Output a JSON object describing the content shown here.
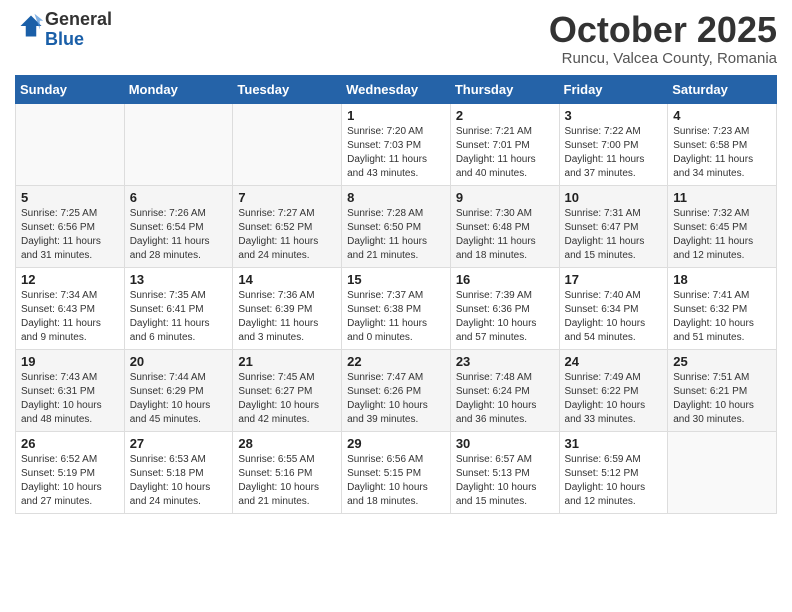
{
  "logo": {
    "general": "General",
    "blue": "Blue"
  },
  "header": {
    "title": "October 2025",
    "subtitle": "Runcu, Valcea County, Romania"
  },
  "weekdays": [
    "Sunday",
    "Monday",
    "Tuesday",
    "Wednesday",
    "Thursday",
    "Friday",
    "Saturday"
  ],
  "weeks": [
    [
      {
        "day": "",
        "sunrise": "",
        "sunset": "",
        "daylight": ""
      },
      {
        "day": "",
        "sunrise": "",
        "sunset": "",
        "daylight": ""
      },
      {
        "day": "",
        "sunrise": "",
        "sunset": "",
        "daylight": ""
      },
      {
        "day": "1",
        "sunrise": "Sunrise: 7:20 AM",
        "sunset": "Sunset: 7:03 PM",
        "daylight": "Daylight: 11 hours and 43 minutes."
      },
      {
        "day": "2",
        "sunrise": "Sunrise: 7:21 AM",
        "sunset": "Sunset: 7:01 PM",
        "daylight": "Daylight: 11 hours and 40 minutes."
      },
      {
        "day": "3",
        "sunrise": "Sunrise: 7:22 AM",
        "sunset": "Sunset: 7:00 PM",
        "daylight": "Daylight: 11 hours and 37 minutes."
      },
      {
        "day": "4",
        "sunrise": "Sunrise: 7:23 AM",
        "sunset": "Sunset: 6:58 PM",
        "daylight": "Daylight: 11 hours and 34 minutes."
      }
    ],
    [
      {
        "day": "5",
        "sunrise": "Sunrise: 7:25 AM",
        "sunset": "Sunset: 6:56 PM",
        "daylight": "Daylight: 11 hours and 31 minutes."
      },
      {
        "day": "6",
        "sunrise": "Sunrise: 7:26 AM",
        "sunset": "Sunset: 6:54 PM",
        "daylight": "Daylight: 11 hours and 28 minutes."
      },
      {
        "day": "7",
        "sunrise": "Sunrise: 7:27 AM",
        "sunset": "Sunset: 6:52 PM",
        "daylight": "Daylight: 11 hours and 24 minutes."
      },
      {
        "day": "8",
        "sunrise": "Sunrise: 7:28 AM",
        "sunset": "Sunset: 6:50 PM",
        "daylight": "Daylight: 11 hours and 21 minutes."
      },
      {
        "day": "9",
        "sunrise": "Sunrise: 7:30 AM",
        "sunset": "Sunset: 6:48 PM",
        "daylight": "Daylight: 11 hours and 18 minutes."
      },
      {
        "day": "10",
        "sunrise": "Sunrise: 7:31 AM",
        "sunset": "Sunset: 6:47 PM",
        "daylight": "Daylight: 11 hours and 15 minutes."
      },
      {
        "day": "11",
        "sunrise": "Sunrise: 7:32 AM",
        "sunset": "Sunset: 6:45 PM",
        "daylight": "Daylight: 11 hours and 12 minutes."
      }
    ],
    [
      {
        "day": "12",
        "sunrise": "Sunrise: 7:34 AM",
        "sunset": "Sunset: 6:43 PM",
        "daylight": "Daylight: 11 hours and 9 minutes."
      },
      {
        "day": "13",
        "sunrise": "Sunrise: 7:35 AM",
        "sunset": "Sunset: 6:41 PM",
        "daylight": "Daylight: 11 hours and 6 minutes."
      },
      {
        "day": "14",
        "sunrise": "Sunrise: 7:36 AM",
        "sunset": "Sunset: 6:39 PM",
        "daylight": "Daylight: 11 hours and 3 minutes."
      },
      {
        "day": "15",
        "sunrise": "Sunrise: 7:37 AM",
        "sunset": "Sunset: 6:38 PM",
        "daylight": "Daylight: 11 hours and 0 minutes."
      },
      {
        "day": "16",
        "sunrise": "Sunrise: 7:39 AM",
        "sunset": "Sunset: 6:36 PM",
        "daylight": "Daylight: 10 hours and 57 minutes."
      },
      {
        "day": "17",
        "sunrise": "Sunrise: 7:40 AM",
        "sunset": "Sunset: 6:34 PM",
        "daylight": "Daylight: 10 hours and 54 minutes."
      },
      {
        "day": "18",
        "sunrise": "Sunrise: 7:41 AM",
        "sunset": "Sunset: 6:32 PM",
        "daylight": "Daylight: 10 hours and 51 minutes."
      }
    ],
    [
      {
        "day": "19",
        "sunrise": "Sunrise: 7:43 AM",
        "sunset": "Sunset: 6:31 PM",
        "daylight": "Daylight: 10 hours and 48 minutes."
      },
      {
        "day": "20",
        "sunrise": "Sunrise: 7:44 AM",
        "sunset": "Sunset: 6:29 PM",
        "daylight": "Daylight: 10 hours and 45 minutes."
      },
      {
        "day": "21",
        "sunrise": "Sunrise: 7:45 AM",
        "sunset": "Sunset: 6:27 PM",
        "daylight": "Daylight: 10 hours and 42 minutes."
      },
      {
        "day": "22",
        "sunrise": "Sunrise: 7:47 AM",
        "sunset": "Sunset: 6:26 PM",
        "daylight": "Daylight: 10 hours and 39 minutes."
      },
      {
        "day": "23",
        "sunrise": "Sunrise: 7:48 AM",
        "sunset": "Sunset: 6:24 PM",
        "daylight": "Daylight: 10 hours and 36 minutes."
      },
      {
        "day": "24",
        "sunrise": "Sunrise: 7:49 AM",
        "sunset": "Sunset: 6:22 PM",
        "daylight": "Daylight: 10 hours and 33 minutes."
      },
      {
        "day": "25",
        "sunrise": "Sunrise: 7:51 AM",
        "sunset": "Sunset: 6:21 PM",
        "daylight": "Daylight: 10 hours and 30 minutes."
      }
    ],
    [
      {
        "day": "26",
        "sunrise": "Sunrise: 6:52 AM",
        "sunset": "Sunset: 5:19 PM",
        "daylight": "Daylight: 10 hours and 27 minutes."
      },
      {
        "day": "27",
        "sunrise": "Sunrise: 6:53 AM",
        "sunset": "Sunset: 5:18 PM",
        "daylight": "Daylight: 10 hours and 24 minutes."
      },
      {
        "day": "28",
        "sunrise": "Sunrise: 6:55 AM",
        "sunset": "Sunset: 5:16 PM",
        "daylight": "Daylight: 10 hours and 21 minutes."
      },
      {
        "day": "29",
        "sunrise": "Sunrise: 6:56 AM",
        "sunset": "Sunset: 5:15 PM",
        "daylight": "Daylight: 10 hours and 18 minutes."
      },
      {
        "day": "30",
        "sunrise": "Sunrise: 6:57 AM",
        "sunset": "Sunset: 5:13 PM",
        "daylight": "Daylight: 10 hours and 15 minutes."
      },
      {
        "day": "31",
        "sunrise": "Sunrise: 6:59 AM",
        "sunset": "Sunset: 5:12 PM",
        "daylight": "Daylight: 10 hours and 12 minutes."
      },
      {
        "day": "",
        "sunrise": "",
        "sunset": "",
        "daylight": ""
      }
    ]
  ]
}
